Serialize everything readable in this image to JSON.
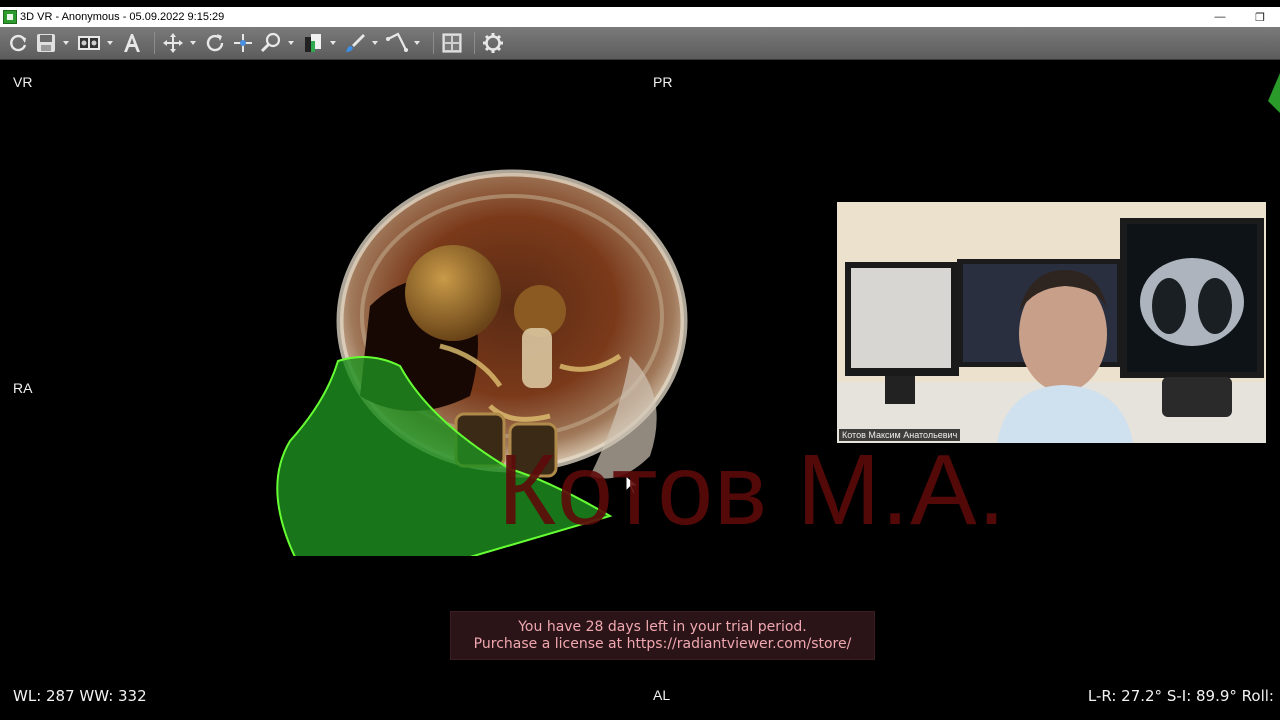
{
  "window": {
    "title": "3D VR - Anonymous - 05.09.2022 9:15:29",
    "minimize_glyph": "—",
    "restore_glyph": "❐"
  },
  "toolbar": {
    "tools": [
      {
        "name": "refresh-icon"
      },
      {
        "name": "save-icon"
      },
      {
        "name": "layout-icon"
      },
      {
        "name": "text-annotation-icon"
      },
      {
        "name": "pan-icon"
      },
      {
        "name": "rotate-icon"
      },
      {
        "name": "move-icon"
      },
      {
        "name": "zoom-icon"
      },
      {
        "name": "window-level-icon"
      },
      {
        "name": "brush-icon"
      },
      {
        "name": "measure-icon"
      },
      {
        "name": "grid-icon"
      },
      {
        "name": "settings-icon"
      }
    ]
  },
  "viewport": {
    "labels": {
      "top_left": "VR",
      "top_center": "PR",
      "left_middle": "RA",
      "bottom_center": "AL"
    },
    "wl_ww": "WL: 287 WW: 332",
    "angles": "L-R: 27.2° S-I: 89.9° Roll:",
    "watermark": "Котов М.А.",
    "colors": {
      "segmentation": "#1f8f1f",
      "segmentation_outline": "#66ff33",
      "watermark": "#5e0a0a"
    }
  },
  "webcam": {
    "name_label": "Котов Максим Анатольевич"
  },
  "trial": {
    "line1": "You have 28 days left in your trial period.",
    "line2": "Purchase a license at https://radiantviewer.com/store/"
  }
}
